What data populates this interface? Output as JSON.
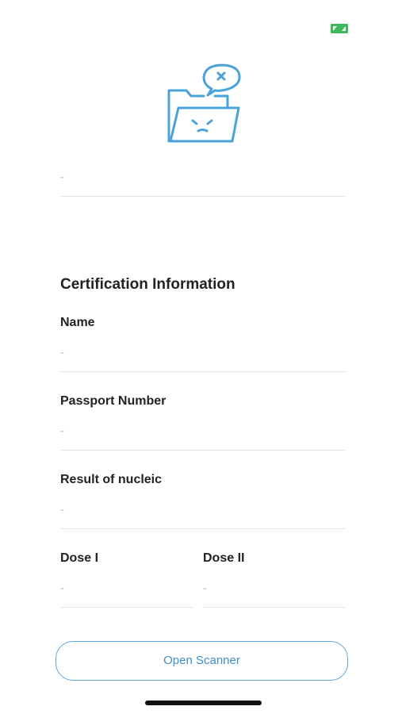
{
  "header": {
    "expand_icon": "expand-arrows-icon",
    "expand_icon_color": "#3dbb5a"
  },
  "illustration": {
    "icon": "sad-folder-icon",
    "color": "#4aa3d8"
  },
  "top_field": {
    "value": "-"
  },
  "certification": {
    "section_title": "Certification Information",
    "name": {
      "label": "Name",
      "value": "-"
    },
    "passport": {
      "label": "Passport Number",
      "value": "-"
    },
    "nucleic": {
      "label": "Result of nucleic",
      "value": "-"
    },
    "dose1": {
      "label": "Dose I",
      "value": "-"
    },
    "dose2": {
      "label": "Dose II",
      "value": "-"
    }
  },
  "actions": {
    "open_scanner_label": "Open Scanner",
    "accent_color": "#5da9d8"
  }
}
